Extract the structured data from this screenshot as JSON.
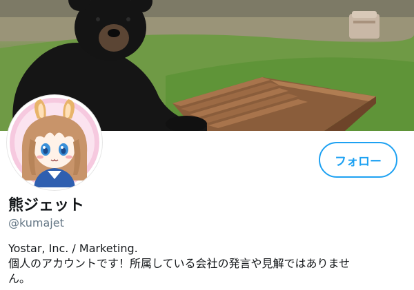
{
  "profile": {
    "display_name": "熊ジェット",
    "handle": "@kumajet",
    "bio": "Yostar, Inc. / Marketing.\n個人のアカウントです！所属している会社の発言や見解ではありませ\nん。"
  },
  "actions": {
    "follow_label": "フォロー"
  },
  "colors": {
    "accent": "#1da1f2",
    "name_text": "#14171a",
    "handle_text": "#657786",
    "avatar_ring": "#f3b8d6"
  },
  "images": {
    "banner": "bear-sitting-at-picnic-table-photo",
    "avatar": "anime-character-avatar"
  }
}
